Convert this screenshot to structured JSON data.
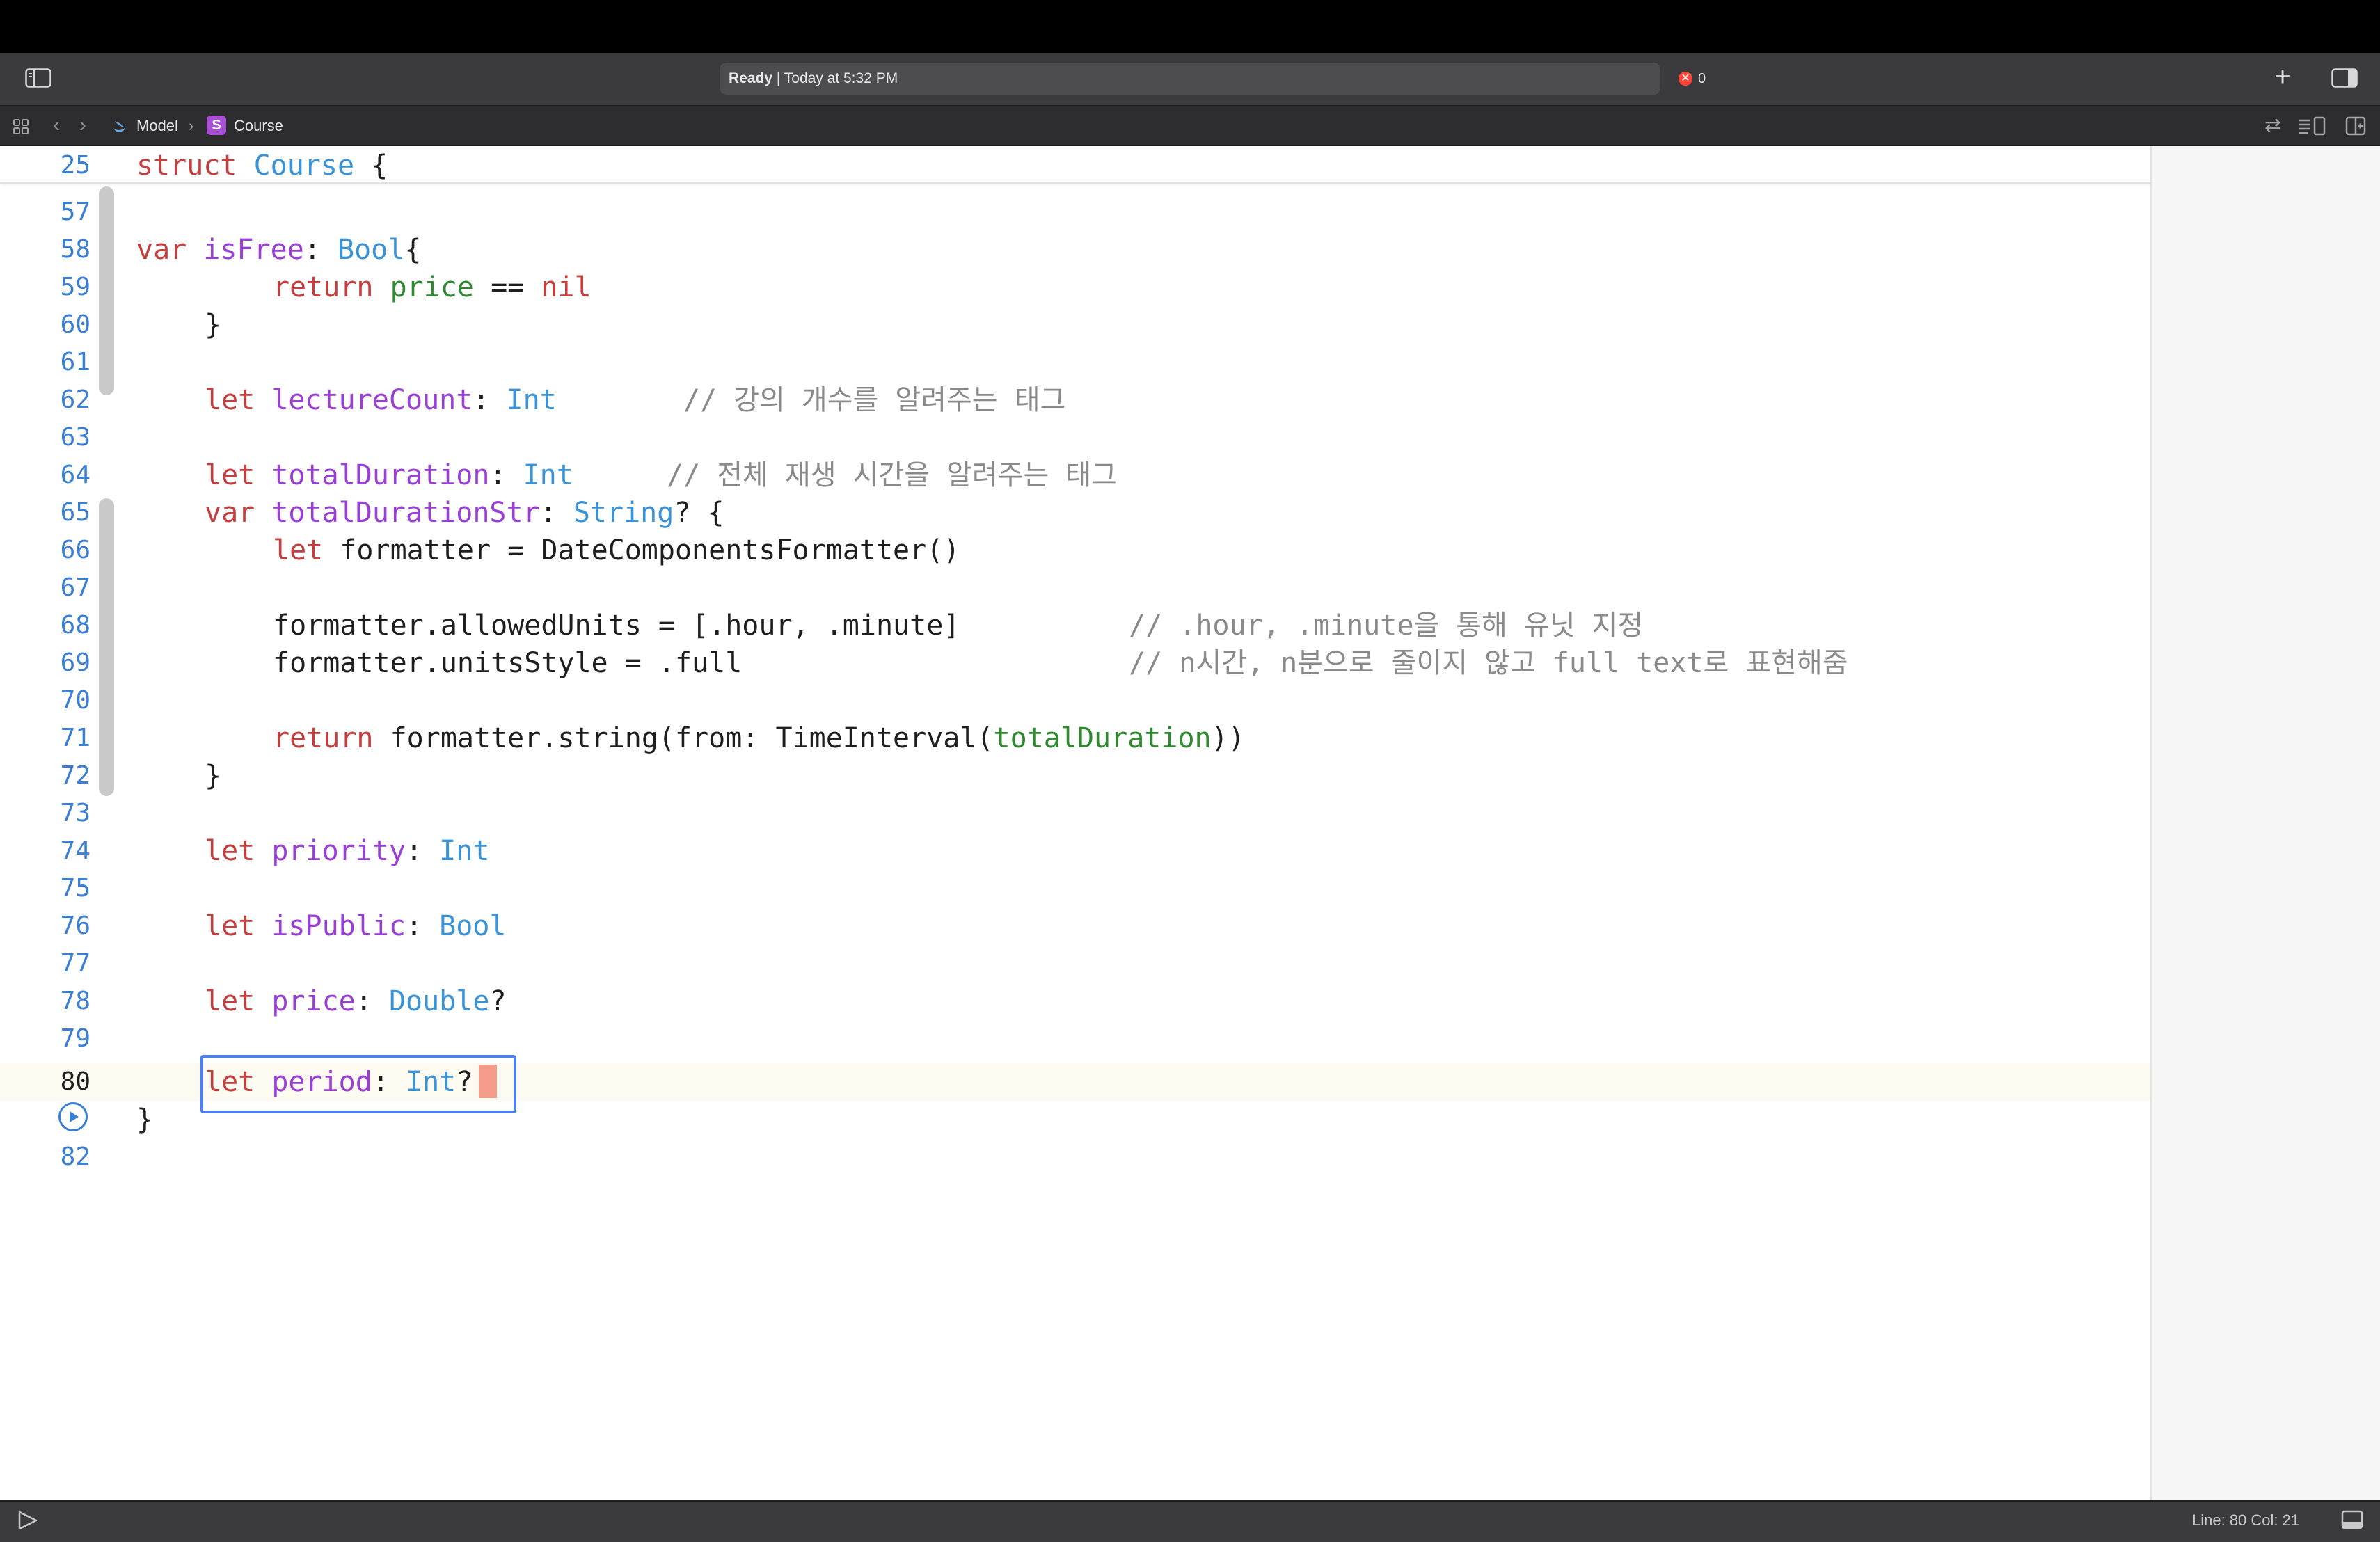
{
  "toolbar": {
    "status_label": "Ready",
    "status_separator": " | ",
    "status_time": "Today at 5:32 PM",
    "error_symbol": "✕",
    "error_count": "0"
  },
  "jumpbar": {
    "breadcrumb": [
      "Model",
      "Course"
    ],
    "separator": "›",
    "struct_badge": "S"
  },
  "icons": {
    "add": "+",
    "back": "‹",
    "forward": "›",
    "swap": "⇄"
  },
  "editor": {
    "sticky": {
      "line": "25",
      "kw": "struct",
      "name": "Course",
      "rest": " {"
    },
    "line_numbers": [
      "57",
      "58",
      "59",
      "60",
      "61",
      "62",
      "63",
      "64",
      "65",
      "66",
      "67",
      "68",
      "69",
      "70",
      "71",
      "72",
      "73",
      "74",
      "75",
      "76",
      "77",
      "78",
      "79",
      "80",
      "",
      "82"
    ],
    "current_line": "80",
    "lines": {
      "l58": {
        "kw": "var",
        "name": "isFree",
        "p": ": ",
        "type": "Bool",
        "rest": "{"
      },
      "l59": {
        "kw": "return",
        "sp": " ",
        "name": "price",
        "op": " == ",
        "nil": "nil"
      },
      "l60": {
        "text": "}"
      },
      "l62": {
        "kw": "let",
        "name": "lectureCount",
        "p": ": ",
        "type": "Int",
        "comment": "// 강의 개수를 알려주는 태그"
      },
      "l64": {
        "kw": "let",
        "name": "totalDuration",
        "p": ": ",
        "type": "Int",
        "comment": "// 전체 재생 시간을 알려주는 태그"
      },
      "l65": {
        "kw": "var",
        "name": "totalDurationStr",
        "p": ": ",
        "type": "String",
        "rest": "? {"
      },
      "l66": {
        "kw": "let",
        "rest": " formatter = DateComponentsFormatter()"
      },
      "l68": {
        "text": "formatter.allowedUnits = [.hour, .minute]",
        "comment": "// .hour, .minute을 통해 유닛 지정"
      },
      "l69": {
        "text": "formatter.unitsStyle = .full",
        "comment": "// n시간, n분으로 줄이지 않고 full text로 표현해줌"
      },
      "l71": {
        "kw": "return",
        "rest": " formatter.string(from: TimeInterval(",
        "arg": "totalDuration",
        "end": "))"
      },
      "l72": {
        "text": "}"
      },
      "l74": {
        "kw": "let",
        "name": "priority",
        "p": ": ",
        "type": "Int"
      },
      "l76": {
        "kw": "let",
        "name": "isPublic",
        "p": ": ",
        "type": "Bool"
      },
      "l78": {
        "kw": "let",
        "name": "price",
        "p": ": ",
        "type": "Double",
        "rest": "?"
      },
      "l80": {
        "kw": "let",
        "name": "period",
        "p": ": ",
        "type": "Int",
        "rest": "?"
      },
      "l81": {
        "text": "}"
      }
    }
  },
  "statusbar": {
    "position": "Line: 80  Col: 21"
  },
  "colors": {
    "keyword": "#c53d3d",
    "property": "#9a3fd6",
    "type": "#3a93d6",
    "identifier_green": "#2f8a2f",
    "comment": "#8a8a8a",
    "line_number": "#3a7fd6",
    "selection_border": "#4f7fe8",
    "cursor": "#f59b8a",
    "toolbar_bg": "#3b3b3d"
  }
}
